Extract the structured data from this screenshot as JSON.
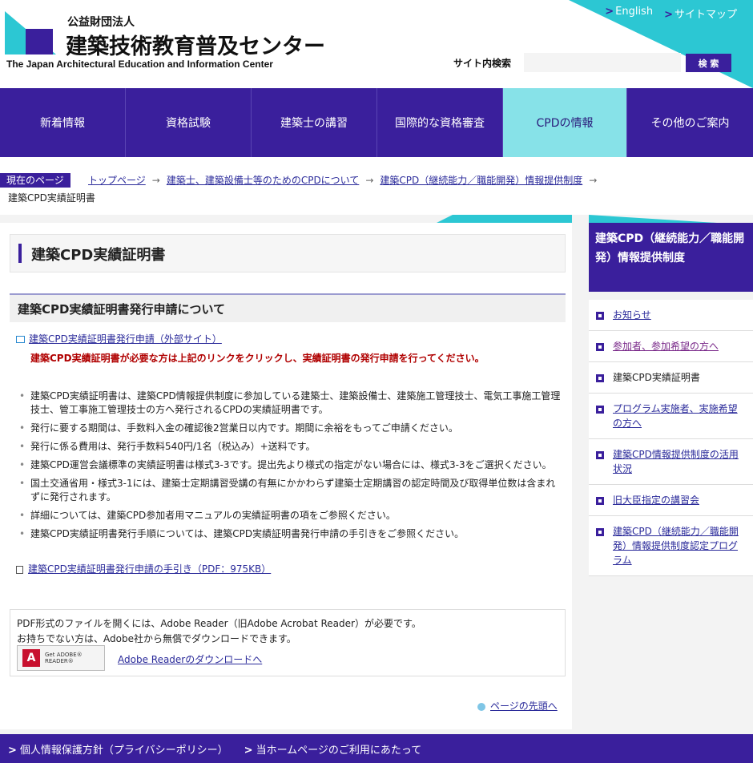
{
  "header": {
    "org_sub": "公益財団法人",
    "org_name": "建築技術教育普及センター",
    "org_en": "The Japan Architectural Education and Information Center",
    "links": [
      {
        "label": "English"
      },
      {
        "label": "サイトマップ"
      }
    ],
    "search_label": "サイト内検索",
    "search_button": "検 索",
    "search_value": ""
  },
  "nav": {
    "items": [
      {
        "label": "新着情報",
        "active": false
      },
      {
        "label": "資格試験",
        "active": false
      },
      {
        "label": "建築士の講習",
        "active": false
      },
      {
        "label": "国際的な資格審査",
        "active": false
      },
      {
        "label": "CPDの情報",
        "active": true
      },
      {
        "label": "その他のご案内",
        "active": false
      }
    ]
  },
  "breadcrumb": {
    "current_label": "現在のページ",
    "items": [
      "トップページ",
      "建築士、建築設備士等のためのCPDについて",
      "建築CPD（継続能力／職能開発）情報提供制度"
    ],
    "last": "建築CPD実績証明書"
  },
  "main": {
    "title": "建築CPD実績証明書",
    "section_title": "建築CPD実績証明書発行申請について",
    "ext_link": "建築CPD実績証明書発行申請（外部サイト）",
    "warning": "建築CPD実績証明書が必要な方は上記のリンクをクリックし、実績証明書の発行申請を行ってください。",
    "bullets": [
      "建築CPD実績証明書は、建築CPD情報提供制度に参加している建築士、建築設備士、建築施工管理技士、電気工事施工管理技士、管工事施工管理技士の方へ発行されるCPDの実績証明書です。",
      "発行に要する期間は、手数料入金の確認後2営業日以内です。期間に余裕をもってご申請ください。",
      "発行に係る費用は、発行手数料540円/1名（税込み）+送料です。",
      "建築CPD運営会議標準の実績証明書は様式3-3です。提出先より様式の指定がない場合には、様式3-3をご選択ください。",
      "国土交通省用・様式3-1には、建築士定期講習受講の有無にかかわらず建築士定期講習の認定時間及び取得単位数は含まれずに発行されます。",
      "詳細については、建築CPD参加者用マニュアルの実績証明書の項をご参照ください。",
      "建築CPD実績証明書発行手順については、建築CPD実績証明書発行申請の手引きをご参照ください。"
    ],
    "pdf_link": "建築CPD実績証明書発行申請の手引き（PDF：975KB）",
    "adobe": {
      "line1": "PDF形式のファイルを開くには、Adobe Reader（旧Adobe Acrobat Reader）が必要です。",
      "line2": "お持ちでない方は、Adobe社から無償でダウンロードできます。",
      "badge_text": "Get ADOBE® READER®",
      "link": "Adobe Readerのダウンロードへ"
    },
    "back_to_top": "ページの先頭へ"
  },
  "sidebar": {
    "heading": "建築CPD（継続能力／職能開発）情報提供制度",
    "items": [
      {
        "label": "お知らせ",
        "type": "link"
      },
      {
        "label": "参加者、参加希望の方へ",
        "type": "visited"
      },
      {
        "label": "建築CPD実績証明書",
        "type": "current"
      },
      {
        "label": "プログラム実施者、実施希望の方へ",
        "type": "link"
      },
      {
        "label": "建築CPD情報提供制度の活用状況",
        "type": "link"
      },
      {
        "label": "旧大臣指定の講習会",
        "type": "link"
      },
      {
        "label": "建築CPD（継続能力／職能開発）情報提供制度認定プログラム",
        "type": "link"
      }
    ]
  },
  "footer": {
    "links": [
      "個人情報保護方針（プライバシーポリシー）",
      "当ホームページのご利用にあたって"
    ]
  },
  "colors": {
    "primary": "#3a1f9c",
    "accent": "#2cc7d3",
    "active_nav": "#87e2e8",
    "warning": "#b00000"
  }
}
